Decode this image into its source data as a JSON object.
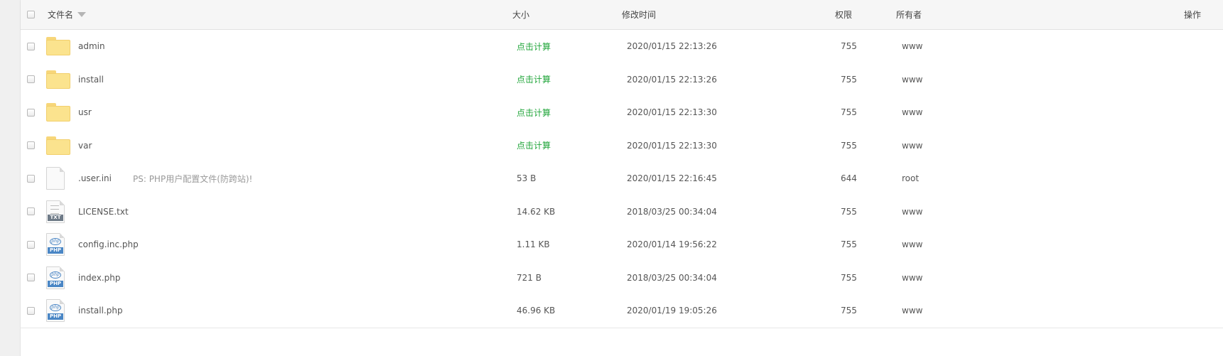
{
  "header": {
    "name": "文件名",
    "size": "大小",
    "mtime": "修改时间",
    "perm": "权限",
    "owner": "所有者",
    "ops": "操作"
  },
  "rows": [
    {
      "name": "admin",
      "type": "folder",
      "icon": "folder-icon",
      "note": "",
      "size": "点击计算",
      "mtime": "2020/01/15 22:13:26",
      "perm": "755",
      "owner": "www"
    },
    {
      "name": "install",
      "type": "folder",
      "icon": "folder-icon",
      "note": "",
      "size": "点击计算",
      "mtime": "2020/01/15 22:13:26",
      "perm": "755",
      "owner": "www"
    },
    {
      "name": "usr",
      "type": "folder",
      "icon": "folder-icon",
      "note": "",
      "size": "点击计算",
      "mtime": "2020/01/15 22:13:30",
      "perm": "755",
      "owner": "www"
    },
    {
      "name": "var",
      "type": "folder",
      "icon": "folder-icon",
      "note": "",
      "size": "点击计算",
      "mtime": "2020/01/15 22:13:30",
      "perm": "755",
      "owner": "www"
    },
    {
      "name": ".user.ini",
      "type": "file",
      "icon": "blank-file-icon",
      "note": "PS: PHP用户配置文件(防跨站)!",
      "size": "53 B",
      "mtime": "2020/01/15 22:16:45",
      "perm": "644",
      "owner": "root"
    },
    {
      "name": "LICENSE.txt",
      "type": "txt",
      "icon": "txt-file-icon",
      "badge": "TXT",
      "note": "",
      "size": "14.62 KB",
      "mtime": "2018/03/25 00:34:04",
      "perm": "755",
      "owner": "www"
    },
    {
      "name": "config.inc.php",
      "type": "php",
      "icon": "php-file-icon",
      "badge": "PHP",
      "logo": "php",
      "note": "",
      "size": "1.11 KB",
      "mtime": "2020/01/14 19:56:22",
      "perm": "755",
      "owner": "www"
    },
    {
      "name": "index.php",
      "type": "php",
      "icon": "php-file-icon",
      "badge": "PHP",
      "logo": "php",
      "note": "",
      "size": "721 B",
      "mtime": "2018/03/25 00:34:04",
      "perm": "755",
      "owner": "www"
    },
    {
      "name": "install.php",
      "type": "php",
      "icon": "php-file-icon",
      "badge": "PHP",
      "logo": "php",
      "note": "",
      "size": "46.96 KB",
      "mtime": "2020/01/19 19:05:26",
      "perm": "755",
      "owner": "www"
    }
  ],
  "colors": {
    "calc_link": "#20a53a",
    "folder": "#fbe38e",
    "php_badge": "#4a86c5",
    "txt_badge": "#6e7a87"
  }
}
